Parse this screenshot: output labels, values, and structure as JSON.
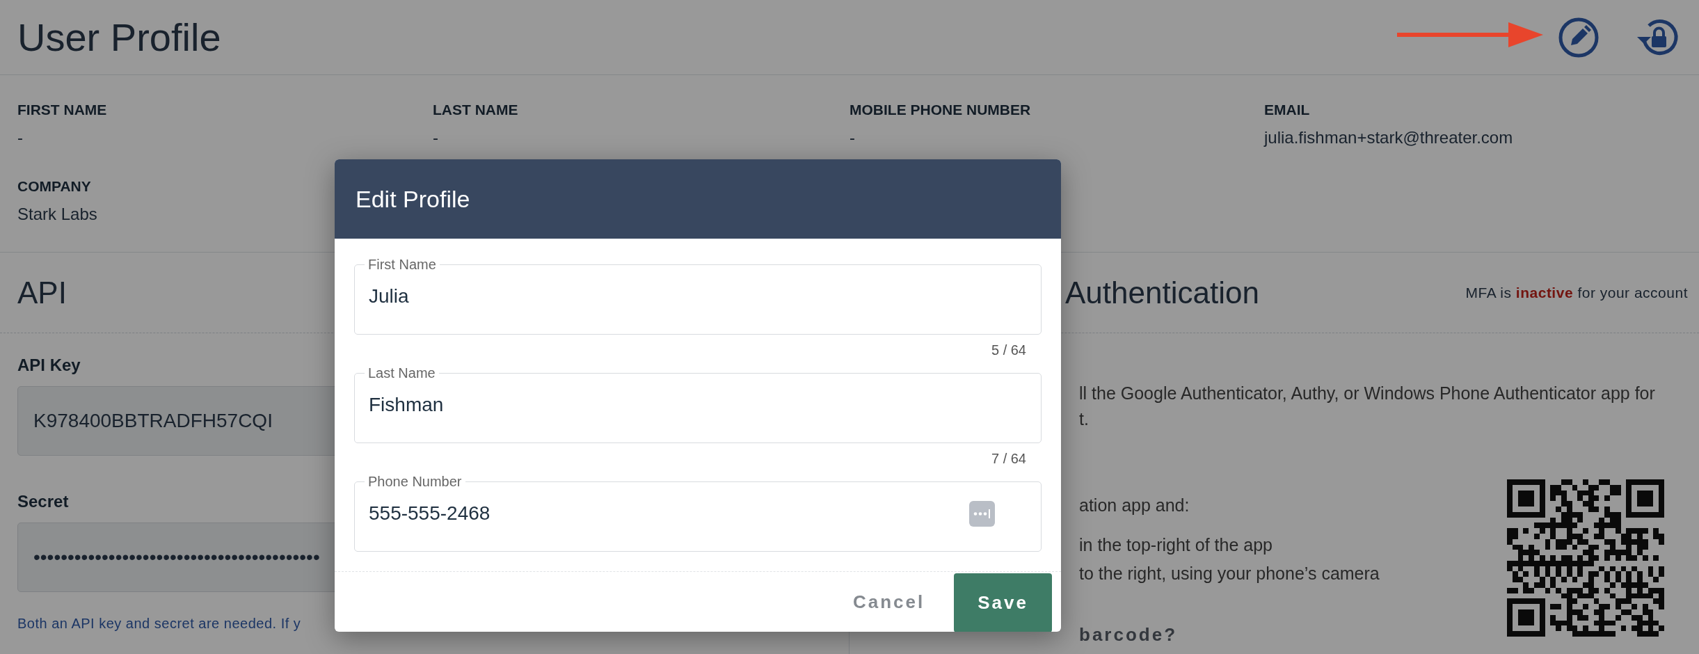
{
  "header": {
    "title": "User Profile"
  },
  "profile_fields": [
    {
      "label": "FIRST NAME",
      "value": "-"
    },
    {
      "label": "LAST NAME",
      "value": "-"
    },
    {
      "label": "MOBILE PHONE NUMBER",
      "value": "-"
    },
    {
      "label": "EMAIL",
      "value": "julia.fishman+stark@threater.com"
    },
    {
      "label": "COMPANY",
      "value": "Stark Labs"
    }
  ],
  "api": {
    "title": "API",
    "fields": [
      {
        "label": "API Key",
        "value": "K978400BBTRADFH57CQI"
      },
      {
        "label": "Secret",
        "value": "••••••••••••••••••••••••••••••••••••••••••"
      }
    ],
    "help": "Both an API key and secret are needed. If y"
  },
  "mfa": {
    "title": "Authentication",
    "status": "MFA is **inactive** for your account",
    "intro_lines": [
      "ll the Google Authenticator, Authy, or Windows Phone Authenticator app for",
      "t."
    ],
    "steps": [
      "ation app and:",
      "in the top-right of the app",
      "to the right, using your phone’s camera"
    ],
    "link": "barcode?"
  },
  "modal": {
    "title": "Edit Profile",
    "fields": [
      {
        "label": "First Name",
        "value": "Julia",
        "counter": "5 / 64",
        "kind": "text"
      },
      {
        "label": "Last Name",
        "value": "Fishman",
        "counter": "7 / 64",
        "kind": "text"
      },
      {
        "label": "Phone Number",
        "value": "555-555-2468",
        "kind": "phone"
      }
    ],
    "buttons": [
      {
        "label": "Cancel",
        "kind": "text"
      },
      {
        "label": "Save",
        "kind": "primary"
      }
    ]
  }
}
